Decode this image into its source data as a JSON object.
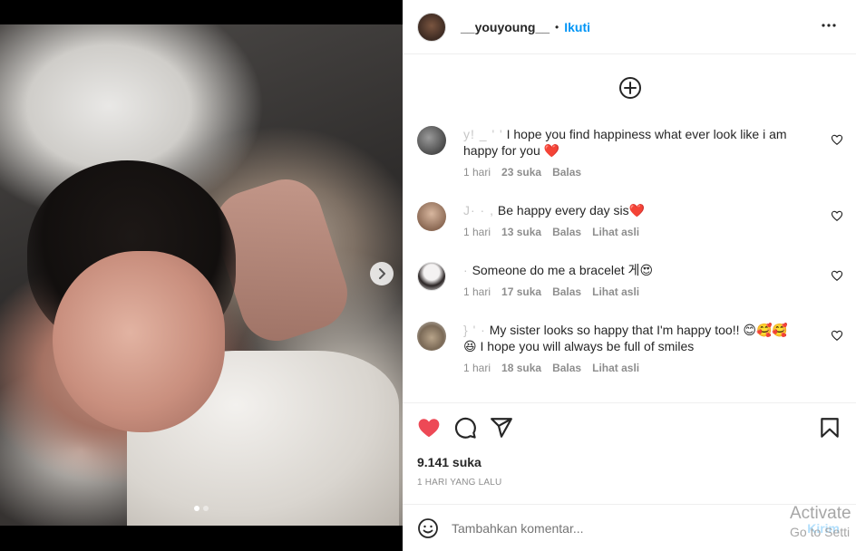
{
  "post": {
    "username": "__youyoung__",
    "separator": "•",
    "follow_label": "Ikuti",
    "more_label": "•••",
    "likes": "9.141 suka",
    "time_ago": "1 HARI YANG LALU",
    "carousel_index": 0,
    "carousel_count": 2
  },
  "comments": [
    {
      "user": "y! _ ' '",
      "text": "I hope you find happiness what ever look like i am happy for you",
      "emoji": "❤️",
      "time": "1 hari",
      "likes": "23 suka",
      "reply": "Balas",
      "see_original": ""
    },
    {
      "user": "J· · ,",
      "text": "Be happy every day sis",
      "emoji": "❤️",
      "time": "1 hari",
      "likes": "13 suka",
      "reply": "Balas",
      "see_original": "Lihat asli"
    },
    {
      "user": "·",
      "text": "Someone do me a bracelet 게",
      "emoji": "😍",
      "time": "1 hari",
      "likes": "17 suka",
      "reply": "Balas",
      "see_original": "Lihat asli"
    },
    {
      "user": "} ' ·",
      "text": "My sister looks so happy that I'm happy too!!",
      "emoji": "😊🥰🥰",
      "text2_emoji": "😆",
      "text2": "I hope you will always be full of smiles",
      "time": "1 hari",
      "likes": "18 suka",
      "reply": "Balas",
      "see_original": "Lihat asli"
    }
  ],
  "add_comment": {
    "placeholder": "Tambahkan komentar...",
    "post_label": "Kirim"
  },
  "watermark": {
    "line1": "Activate",
    "line2": "Go to Setti"
  },
  "icons": {
    "like": "heart-filled-icon",
    "comment": "comment-icon",
    "share": "paper-plane-icon",
    "save": "bookmark-icon",
    "emoji": "smiley-icon",
    "add": "plus-circle-icon",
    "next": "chevron-right-icon",
    "more": "more-horizontal-icon"
  },
  "colors": {
    "like_red": "#ed4956",
    "follow_blue": "#0095f6",
    "muted_text": "#8e8e8e"
  }
}
